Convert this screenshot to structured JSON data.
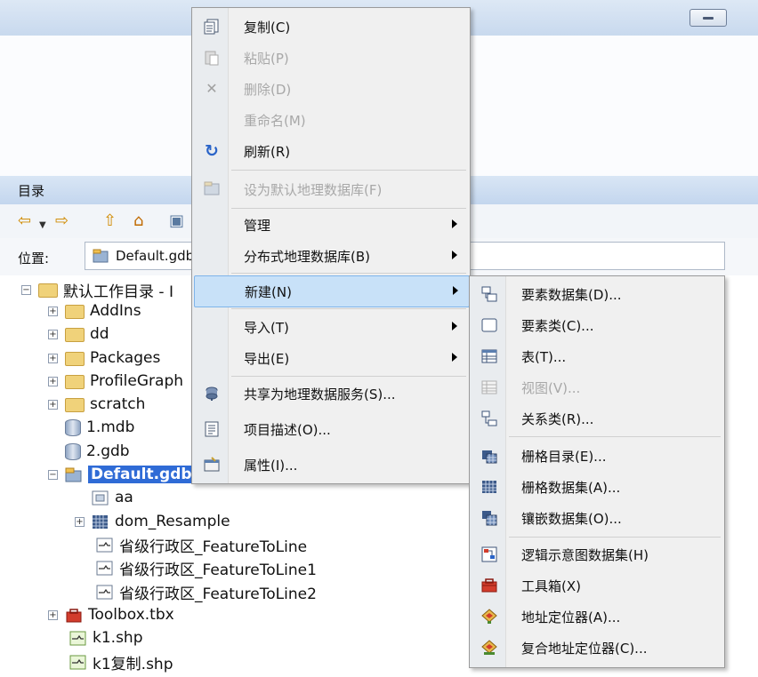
{
  "catalog": {
    "title": "目录",
    "location_label": "位置:",
    "location_value": "Default.gdb"
  },
  "tree": {
    "root": "默认工作目录 - I",
    "items": [
      {
        "label": "AddIns"
      },
      {
        "label": "dd"
      },
      {
        "label": "Packages"
      },
      {
        "label": "ProfileGraph"
      },
      {
        "label": "scratch"
      },
      {
        "label": "1.mdb"
      },
      {
        "label": "2.gdb"
      },
      {
        "label": "Default.gdb"
      },
      {
        "label": "aa"
      },
      {
        "label": "dom_Resample"
      },
      {
        "label": "省级行政区_FeatureToLine"
      },
      {
        "label": "省级行政区_FeatureToLine1"
      },
      {
        "label": "省级行政区_FeatureToLine2"
      },
      {
        "label": "Toolbox.tbx"
      },
      {
        "label": "k1.shp"
      },
      {
        "label": "k1复制.shp"
      }
    ]
  },
  "context_menu": {
    "items": [
      {
        "label": "复制(C)",
        "icon": "copy-icon",
        "enabled": true
      },
      {
        "label": "粘贴(P)",
        "icon": "paste-icon",
        "enabled": false
      },
      {
        "label": "删除(D)",
        "icon": "delete-icon",
        "enabled": false
      },
      {
        "label": "重命名(M)",
        "icon": "",
        "enabled": false
      },
      {
        "label": "刷新(R)",
        "icon": "refresh-icon",
        "enabled": true
      },
      {
        "label": "设为默认地理数据库(F)",
        "icon": "default-gdb-icon",
        "enabled": false
      },
      {
        "label": "管理",
        "icon": "",
        "enabled": true
      },
      {
        "label": "分布式地理数据库(B)",
        "icon": "",
        "enabled": true
      },
      {
        "label": "新建(N)",
        "icon": "",
        "enabled": true
      },
      {
        "label": "导入(T)",
        "icon": "",
        "enabled": true
      },
      {
        "label": "导出(E)",
        "icon": "",
        "enabled": true
      },
      {
        "label": "共享为地理数据服务(S)...",
        "icon": "share-service-icon",
        "enabled": true
      },
      {
        "label": "项目描述(O)...",
        "icon": "item-description-icon",
        "enabled": true
      },
      {
        "label": "属性(I)...",
        "icon": "properties-icon",
        "enabled": true
      }
    ]
  },
  "new_submenu": {
    "items": [
      {
        "label": "要素数据集(D)...",
        "icon": "feature-dataset-icon",
        "enabled": true
      },
      {
        "label": "要素类(C)...",
        "icon": "feature-class-icon",
        "enabled": true
      },
      {
        "label": "表(T)...",
        "icon": "table-icon",
        "enabled": true
      },
      {
        "label": "视图(V)...",
        "icon": "view-icon",
        "enabled": false
      },
      {
        "label": "关系类(R)...",
        "icon": "relationship-class-icon",
        "enabled": true
      },
      {
        "label": "栅格目录(E)...",
        "icon": "raster-catalog-icon",
        "enabled": true
      },
      {
        "label": "栅格数据集(A)...",
        "icon": "raster-dataset-icon",
        "enabled": true
      },
      {
        "label": "镶嵌数据集(O)...",
        "icon": "mosaic-dataset-icon",
        "enabled": true
      },
      {
        "label": "逻辑示意图数据集(H)",
        "icon": "schematic-dataset-icon",
        "enabled": true
      },
      {
        "label": "工具箱(X)",
        "icon": "toolbox-icon",
        "enabled": true
      },
      {
        "label": "地址定位器(A)...",
        "icon": "address-locator-icon",
        "enabled": true
      },
      {
        "label": "复合地址定位器(C)...",
        "icon": "composite-locator-icon",
        "enabled": true
      }
    ]
  }
}
